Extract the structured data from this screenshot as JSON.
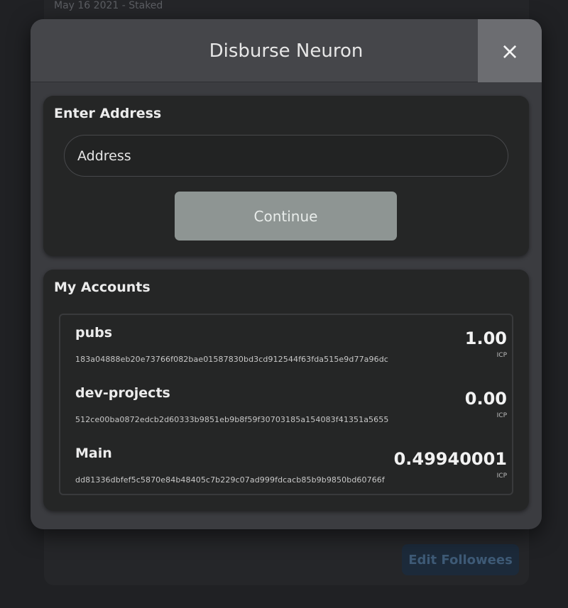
{
  "background": {
    "top_text": "May 16 2021 - Staked",
    "edit_followees_label": "Edit Followees"
  },
  "modal": {
    "title": "Disburse Neuron",
    "close_label": "×",
    "address_section": {
      "title": "Enter Address",
      "input_placeholder": "Address",
      "input_value": "",
      "continue_label": "Continue"
    },
    "accounts_section": {
      "title": "My Accounts",
      "accounts": [
        {
          "name": "pubs",
          "id": "183a04888eb20e73766f082bae01587830bd3cd912544f63fda515e9d77a96dc",
          "balance": "1.00",
          "unit": "ICP"
        },
        {
          "name": "dev-projects",
          "id": "512ce00ba0872edcb2d60333b9851eb9b8f59f30703185a154083f41351a5655",
          "balance": "0.00",
          "unit": "ICP"
        },
        {
          "name": "Main",
          "id": "dd81336dbfef5c5870e84b48405c7b229c07ad999fdcacb85b9b9850bd60766f",
          "balance": "0.49940001",
          "unit": "ICP"
        }
      ]
    }
  },
  "colors": {
    "modal_bg": "#3b3c40",
    "panel_bg": "#252626",
    "continue_bg": "#8e9593",
    "close_bg": "#6c6d71"
  }
}
